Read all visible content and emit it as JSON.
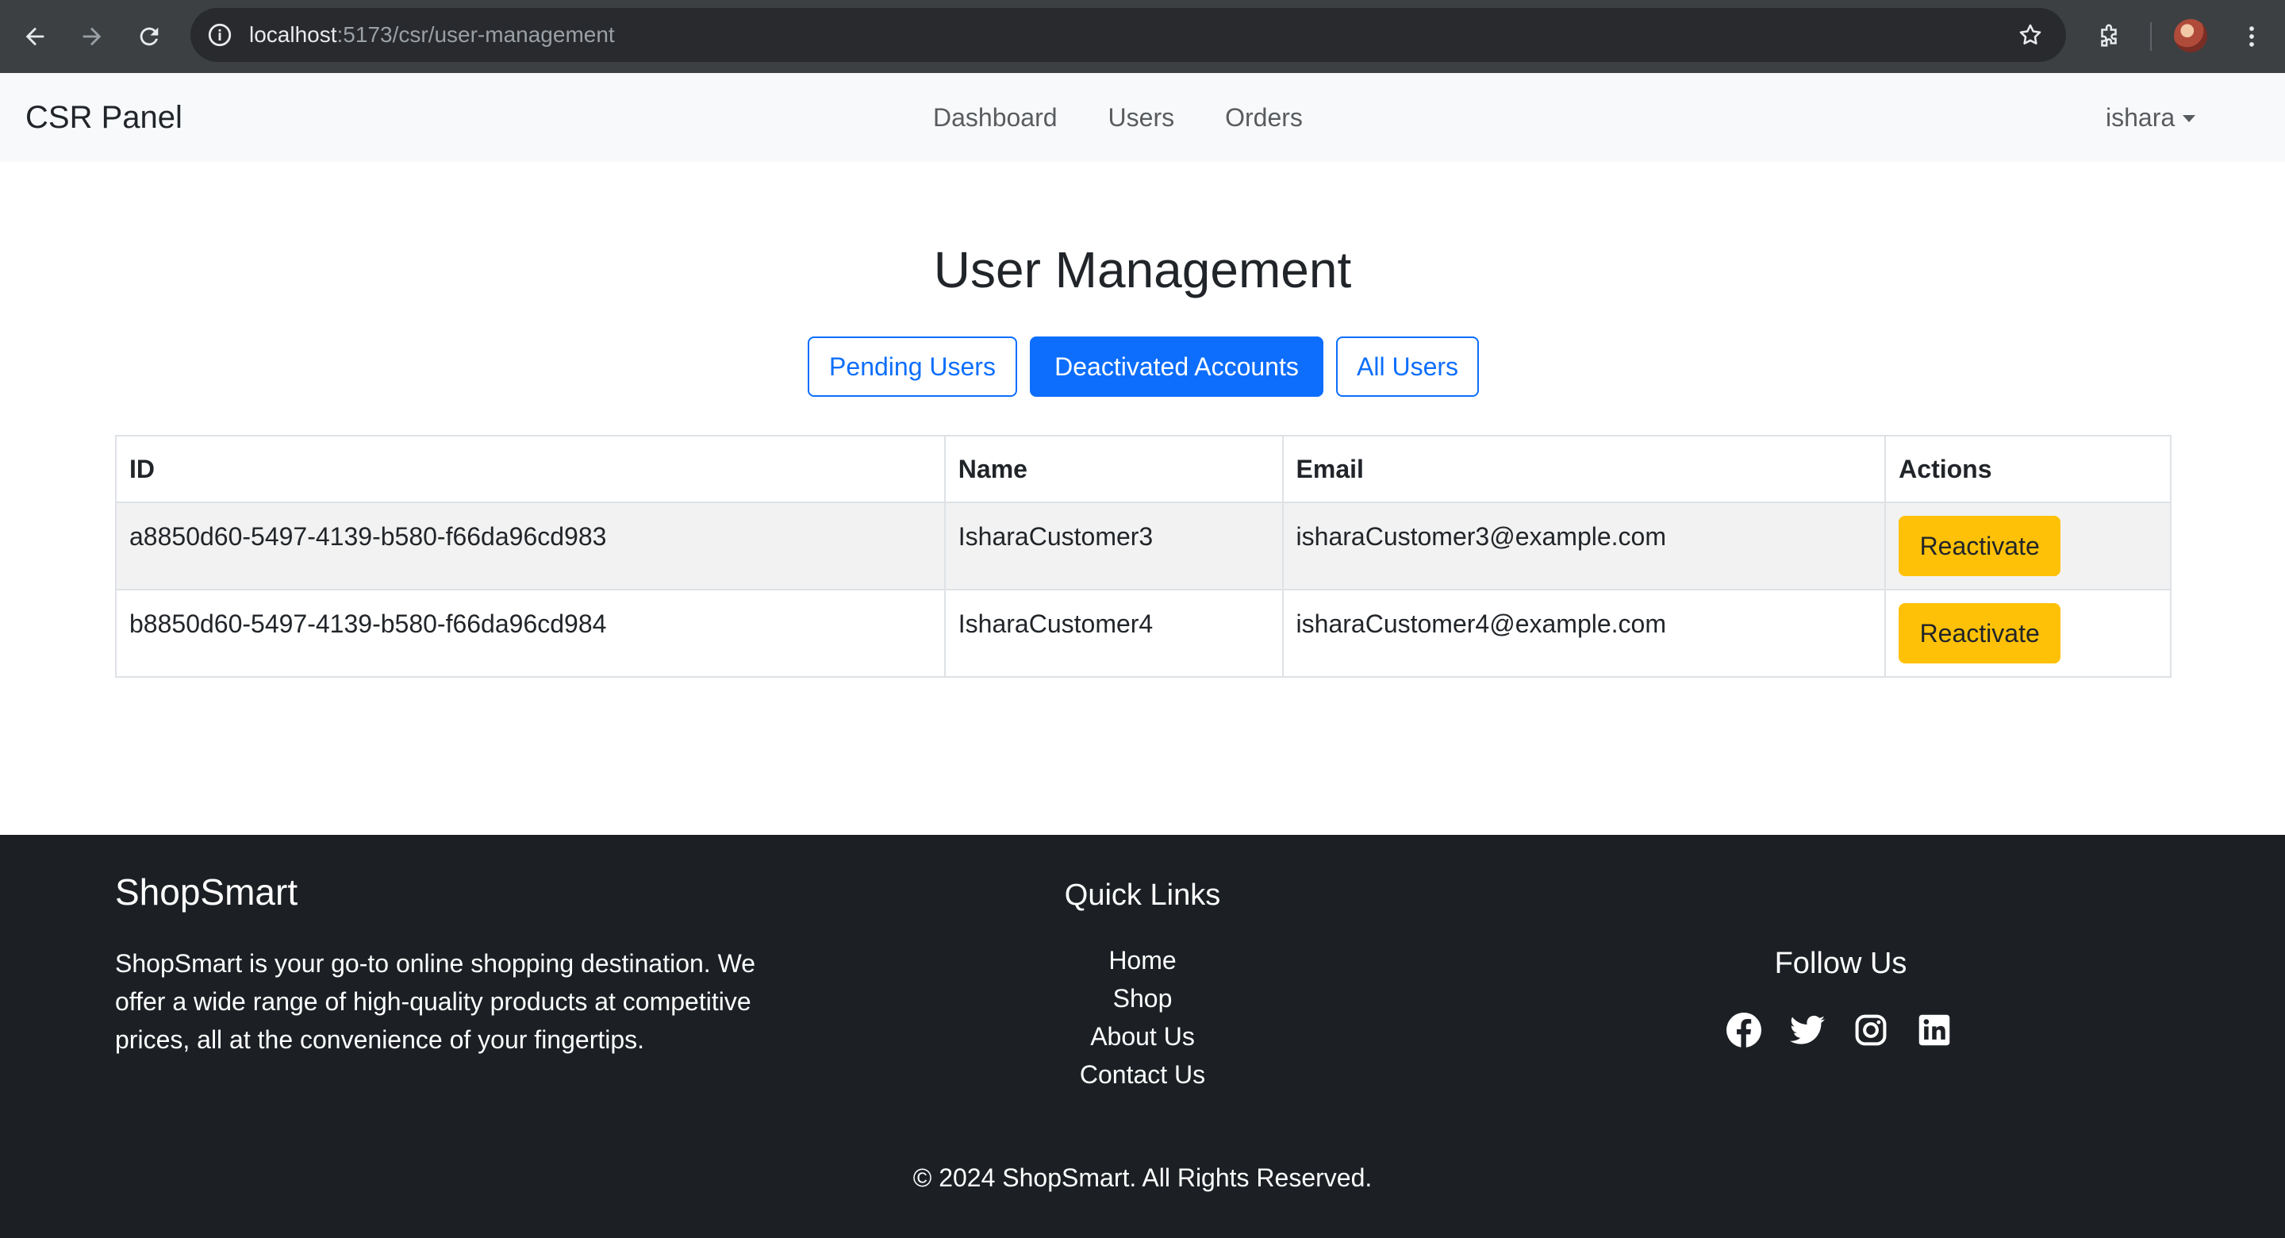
{
  "browser": {
    "url_host": "localhost",
    "url_rest": ":5173/csr/user-management"
  },
  "navbar": {
    "brand": "CSR Panel",
    "links": [
      "Dashboard",
      "Users",
      "Orders"
    ],
    "user": "ishara"
  },
  "main": {
    "title": "User Management",
    "tabs": [
      {
        "label": "Pending Users",
        "active": false
      },
      {
        "label": "Deactivated Accounts",
        "active": true
      },
      {
        "label": "All Users",
        "active": false
      }
    ],
    "table": {
      "headers": [
        "ID",
        "Name",
        "Email",
        "Actions"
      ],
      "rows": [
        {
          "id": "a8850d60-5497-4139-b580-f66da96cd983",
          "name": "IsharaCustomer3",
          "email": "isharaCustomer3@example.com",
          "action": "Reactivate"
        },
        {
          "id": "b8850d60-5497-4139-b580-f66da96cd984",
          "name": "IsharaCustomer4",
          "email": "isharaCustomer4@example.com",
          "action": "Reactivate"
        }
      ]
    }
  },
  "footer": {
    "brand": "ShopSmart",
    "description": "ShopSmart is your go-to online shopping destination. We offer a wide range of high-quality products at competitive prices, all at the convenience of your fingertips.",
    "quick_links_title": "Quick Links",
    "quick_links": [
      "Home",
      "Shop",
      "About Us",
      "Contact Us"
    ],
    "follow_title": "Follow Us",
    "social_icons": [
      "facebook-icon",
      "twitter-icon",
      "instagram-icon",
      "linkedin-icon"
    ],
    "copyright": "© 2024 ShopSmart. All Rights Reserved."
  },
  "colors": {
    "primary": "#0d6efd",
    "warning": "#ffc107",
    "footer_bg": "#1c2025",
    "navbar_bg": "#f8f9fa"
  }
}
